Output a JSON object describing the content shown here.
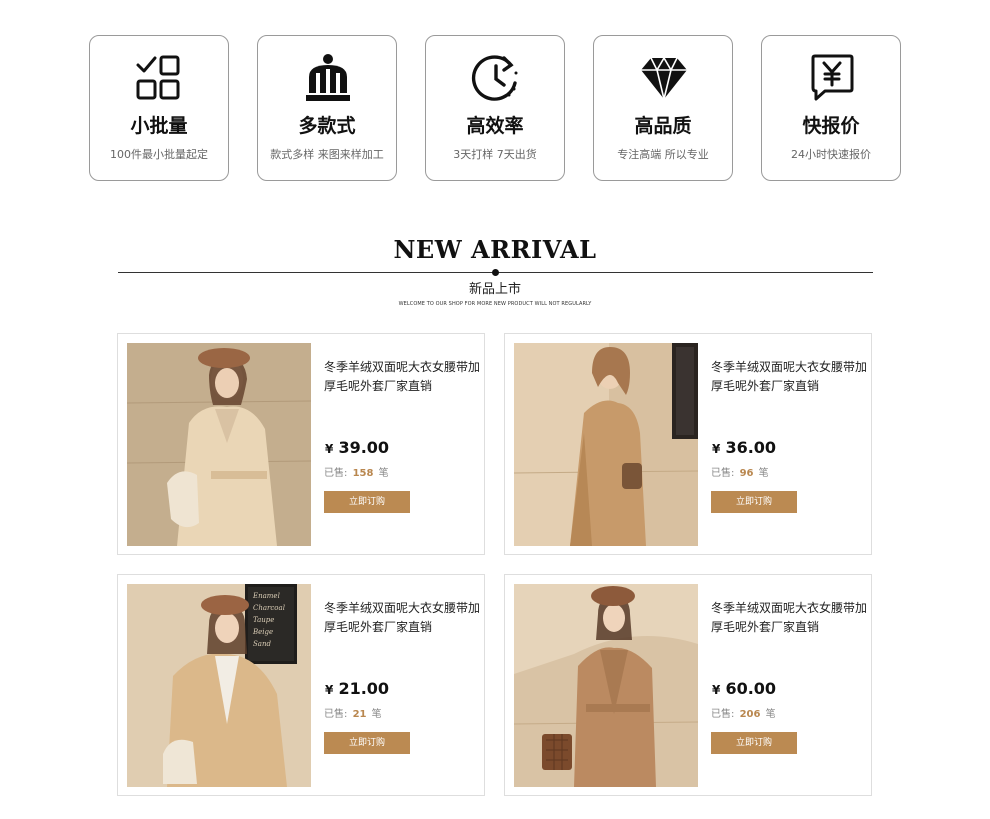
{
  "features": [
    {
      "icon": "checklist-grid-icon",
      "title": "小批量",
      "desc": "100件最小批量起定"
    },
    {
      "icon": "factory-building-icon",
      "title": "多款式",
      "desc": "款式多样 来图来样加工"
    },
    {
      "icon": "clock-cycle-icon",
      "title": "高效率",
      "desc": "3天打样 7天出货"
    },
    {
      "icon": "diamond-icon",
      "title": "高品质",
      "desc": "专注高端 所以专业"
    },
    {
      "icon": "yen-chat-icon",
      "title": "快报价",
      "desc": "24小时快速报价"
    }
  ],
  "section": {
    "title": "NEW ARRIVAL",
    "subtitle": "新品上市",
    "tagline": "WELCOME TO OUR SHOP FOR MORE NEW PRODUCT WILL NOT REGULARLY"
  },
  "products": [
    {
      "title": "冬季羊绒双面呢大衣女腰带加厚毛呢外套厂家直销",
      "currency": "¥",
      "price": "39.00",
      "sold_label": "已售:",
      "sold_count": "158",
      "sold_unit": "笔",
      "button": "立即订购"
    },
    {
      "title": "冬季羊绒双面呢大衣女腰带加厚毛呢外套厂家直销",
      "currency": "¥",
      "price": "36.00",
      "sold_label": "已售:",
      "sold_count": "96",
      "sold_unit": "笔",
      "button": "立即订购"
    },
    {
      "title": "冬季羊绒双面呢大衣女腰带加厚毛呢外套厂家直销",
      "currency": "¥",
      "price": "21.00",
      "sold_label": "已售:",
      "sold_count": "21",
      "sold_unit": "笔",
      "button": "立即订购"
    },
    {
      "title": "冬季羊绒双面呢大衣女腰带加厚毛呢外套厂家直销",
      "currency": "¥",
      "price": "60.00",
      "sold_label": "已售:",
      "sold_count": "206",
      "sold_unit": "笔",
      "button": "立即订购"
    }
  ],
  "colors": {
    "accent": "#bb8a52",
    "sold_highlight": "#b9874f",
    "border": "#dedede"
  },
  "photo_sign_lines": [
    "Enamel",
    "Charcoal",
    "Taupe",
    "Beige",
    "Sand"
  ]
}
